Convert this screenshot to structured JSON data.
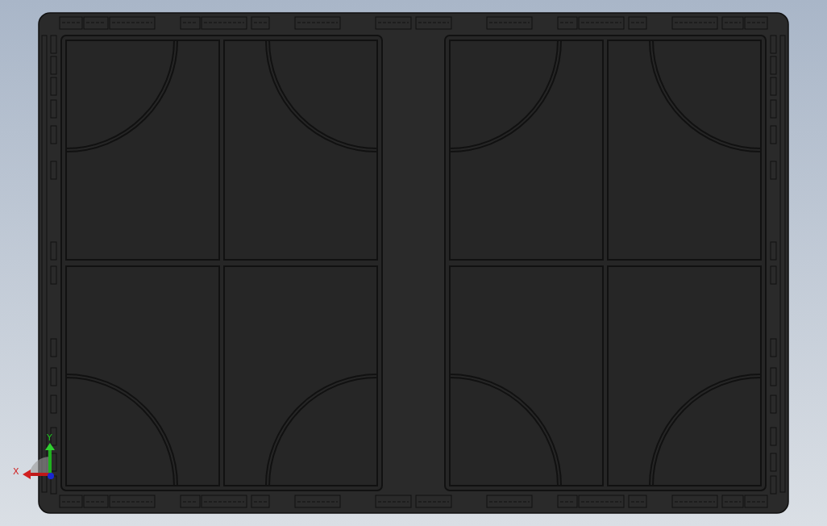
{
  "viewport": {
    "axes": [
      {
        "label": "X"
      },
      {
        "label": "Y"
      }
    ]
  }
}
